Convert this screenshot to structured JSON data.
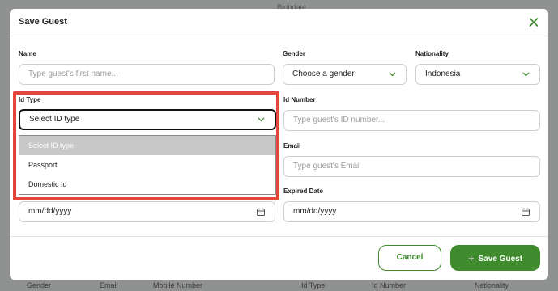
{
  "background": {
    "top_hint": "Birthdate",
    "footer_columns": [
      "Gender",
      "Email",
      "Mobile Number",
      "Id Type",
      "Id Number",
      "Nationality"
    ]
  },
  "modal": {
    "title": "Save Guest",
    "close_icon": "close-icon",
    "fields": {
      "name": {
        "label": "Name",
        "placeholder": "Type guest's first name..."
      },
      "gender": {
        "label": "Gender",
        "value": "Choose a gender"
      },
      "nationality": {
        "label": "Nationality",
        "value": "Indonesia"
      },
      "id_type": {
        "label": "Id Type",
        "value": "Select ID type"
      },
      "id_number": {
        "label": "Id Number",
        "placeholder": "Type guest's ID number..."
      },
      "email": {
        "label": "Email",
        "placeholder": "Type guest's Email"
      },
      "birthdate": {
        "value": "mm/dd/yyyy"
      },
      "expired_date": {
        "label": "Expired Date",
        "value": "mm/dd/yyyy"
      }
    },
    "id_type_options": [
      "Select ID type",
      "Passport",
      "Domestic Id"
    ],
    "buttons": {
      "cancel": "Cancel",
      "save": "Save Guest",
      "save_icon": "+"
    }
  },
  "colors": {
    "accent": "#3f8b2e",
    "highlight": "#e5463c"
  }
}
